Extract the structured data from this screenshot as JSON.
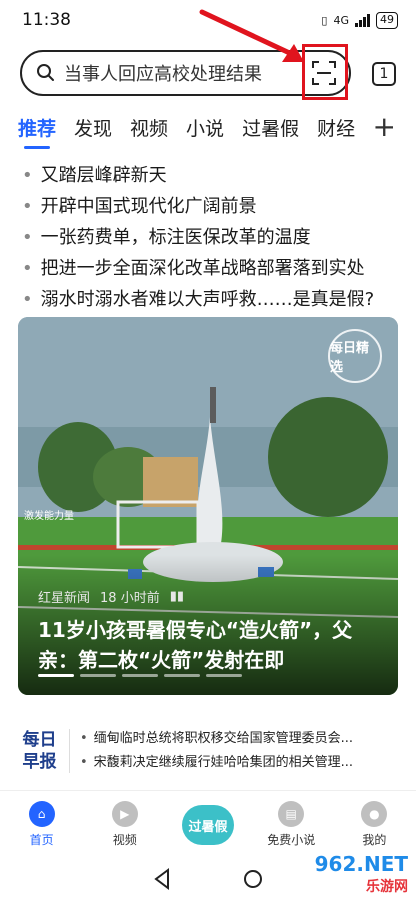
{
  "status": {
    "time": "11:38",
    "battery": "49",
    "network": "4G"
  },
  "search": {
    "placeholder": "当事人回应高校处理结果",
    "tab_count": "1"
  },
  "tabs": [
    "推荐",
    "发现",
    "视频",
    "小说",
    "过暑假",
    "财经"
  ],
  "news": [
    "又踏层峰辟新天",
    "开辟中国式现代化广阔前景",
    "一张药费单，标注医保改革的温度",
    "把进一步全面深化改革战略部署落到实处",
    "溺水时溺水者难以大声呼救……是真是假?"
  ],
  "card": {
    "source": "红星新闻",
    "time": "18 小时前",
    "title": "11岁小孩哥暑假专心“造火箭”，父亲：第二枚“火箭”发射在即",
    "badge": "每日精选",
    "sign_text": "激发能力量"
  },
  "daily": {
    "logo_line1": "每日",
    "logo_line2": "早报",
    "items": [
      "缅甸临时总统将职权移交给国家管理委员会...",
      "宋馥莉决定继续履行娃哈哈集团的相关管理..."
    ]
  },
  "bottom_nav": [
    "首页",
    "视频",
    "过暑假",
    "免费小说",
    "我的"
  ],
  "watermark": {
    "a": "962",
    "b": ".NET",
    "c": "乐游网"
  },
  "colors": {
    "accent": "#2364ff",
    "highlight": "#e0141e"
  }
}
